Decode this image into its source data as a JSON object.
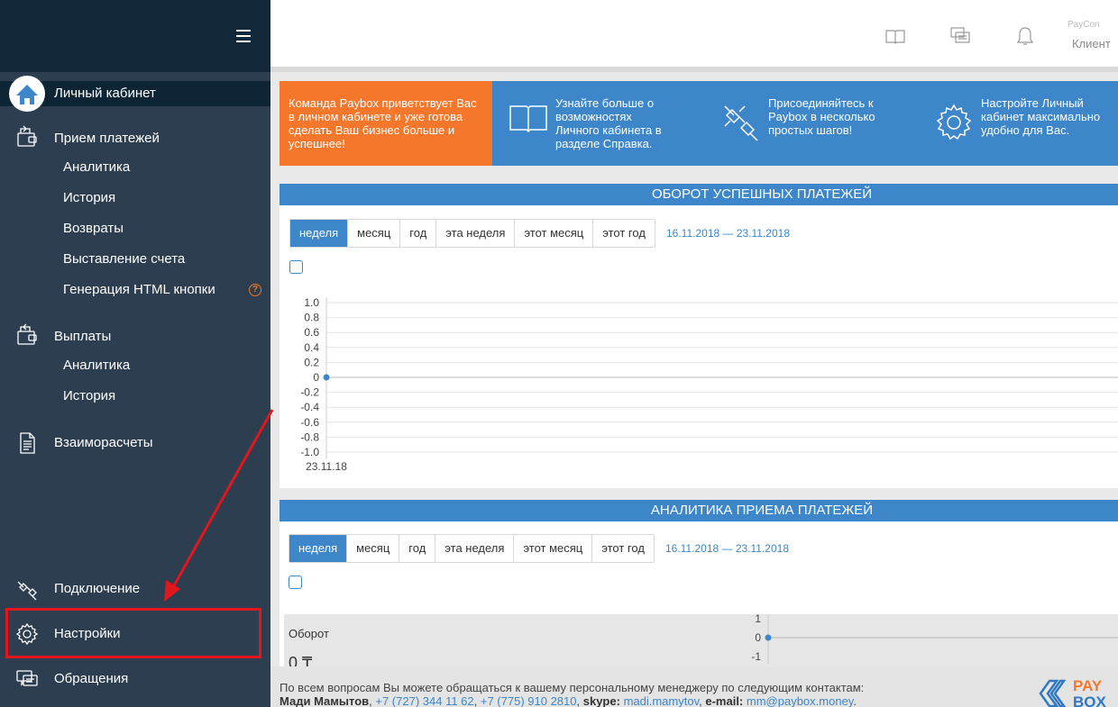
{
  "sidebar": {
    "dashboard": "Личный кабинет",
    "payments": "Прием платежей",
    "payments_sub": [
      "Аналитика",
      "История",
      "Возвраты",
      "Выставление счета",
      "Генерация HTML кнопки"
    ],
    "help_badge": "?",
    "payouts": "Выплаты",
    "payouts_sub": [
      "Аналитика",
      "История"
    ],
    "settlements": "Взаиморасчеты",
    "connection": "Подключение",
    "settings": "Настройки",
    "requests": "Обращения"
  },
  "header": {
    "user_name": "PayCon",
    "role": "Клиент"
  },
  "banner": {
    "welcome": "Команда Paybox приветствует Вас в личном кабинете и уже готова сделать Ваш бизнес больше и успешнее!",
    "help": "Узнайте больше о возможностях Личного кабинета в разделе Справка.",
    "join": "Присоединяйтесь к Paybox в несколько простых шагов!",
    "configure": "Настройте Личный кабинет максимально удобно для Вас."
  },
  "panel1": {
    "title": "ОБОРОТ УСПЕШНЫХ ПЛАТЕЖЕЙ",
    "tabs": [
      "неделя",
      "месяц",
      "год",
      "эта неделя",
      "этот месяц",
      "этот год"
    ],
    "daterange": "16.11.2018 — 23.11.2018"
  },
  "panel2": {
    "title": "АНАЛИТИКА ПРИЕМА ПЛАТЕЖЕЙ",
    "tabs": [
      "неделя",
      "месяц",
      "год",
      "эта неделя",
      "этот месяц",
      "этот год"
    ],
    "daterange": "16.11.2018 — 23.11.2018",
    "metric_label": "Оборот",
    "metric_value": "0 ₸"
  },
  "chart_data": [
    {
      "type": "line",
      "x": [
        "23.11.18"
      ],
      "series": [
        {
          "values": [
            0
          ]
        }
      ],
      "yticks": [
        "1.0",
        "0.8",
        "0.6",
        "0.4",
        "0.2",
        "0",
        "-0.2",
        "-0.4",
        "-0.6",
        "-0.8",
        "-1.0"
      ],
      "ylim": [
        -1,
        1
      ],
      "xlabel": "",
      "ylabel": "",
      "grid": true,
      "color": "#3d86c9"
    },
    {
      "type": "line",
      "x": [
        ""
      ],
      "series": [
        {
          "values": [
            0
          ]
        }
      ],
      "yticks": [
        "1",
        "0",
        "-1"
      ],
      "ylim": [
        -1,
        1
      ],
      "grid": true,
      "color": "#3d86c9"
    }
  ],
  "footer": {
    "intro": "По всем вопросам Вы можете обращаться к вашему персональному менеджеру по следующим контактам:",
    "manager": "Мади Мамытов",
    "phone1": "+7 (727) 344 11 62",
    "phone2": "+7 (775) 910 2810",
    "skype_label": "skype:",
    "skype": "madi.mamytov",
    "email_label": "e-mail:",
    "email": "mm@paybox.money",
    "logo_top": "PAY",
    "logo_bottom": "BOX"
  },
  "colors": {
    "sidebar": "#2c3e50",
    "accent": "#3d86c9",
    "orange": "#f5772b",
    "highlight": "#e3161c"
  }
}
